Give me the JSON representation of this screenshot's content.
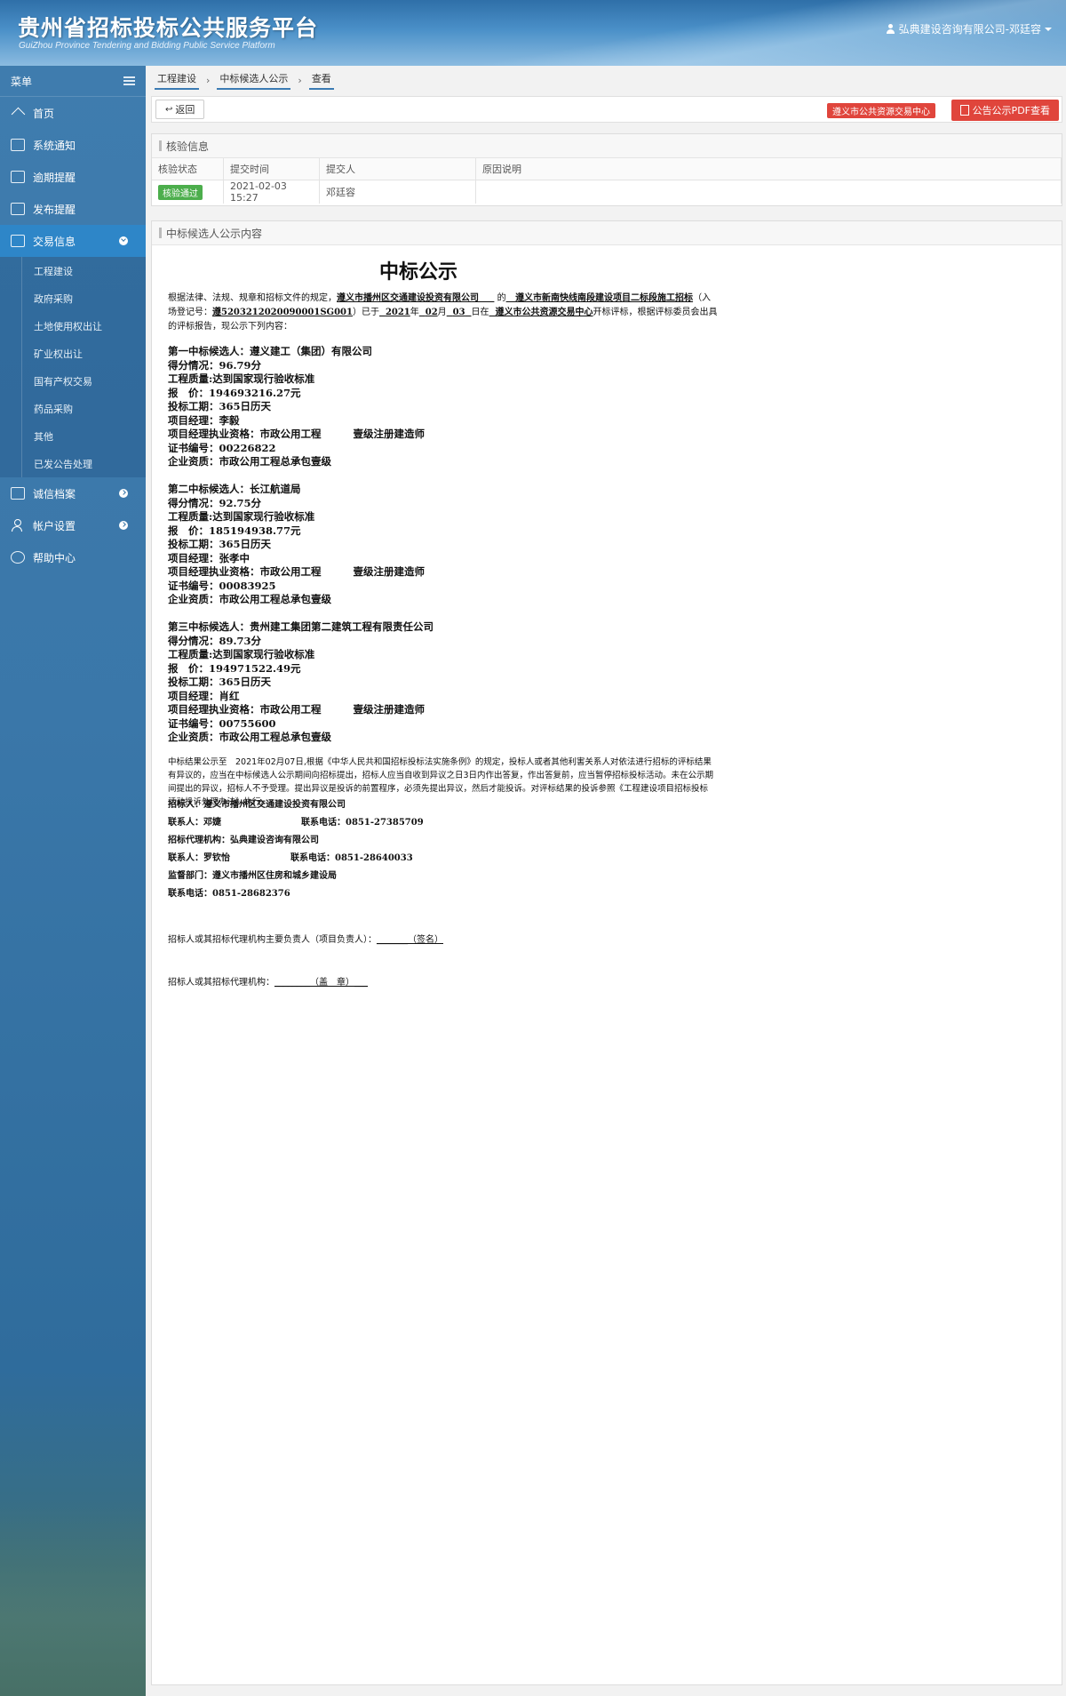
{
  "header": {
    "title_cn": "贵州省招标投标公共服务平台",
    "title_en": "GuiZhou Province Tendering and Bidding Public Service Platform",
    "user": "弘典建设咨询有限公司-邓廷容"
  },
  "sidebar": {
    "menu_label": "菜单",
    "items": [
      {
        "label": "首页",
        "icon": "home-icon"
      },
      {
        "label": "系统通知",
        "icon": "monitor-icon"
      },
      {
        "label": "逾期提醒",
        "icon": "list-icon"
      },
      {
        "label": "发布提醒",
        "icon": "list-icon"
      },
      {
        "label": "交易信息",
        "icon": "list-icon"
      }
    ],
    "sub_items": [
      "工程建设",
      "政府采购",
      "土地使用权出让",
      "矿业权出让",
      "国有产权交易",
      "药品采购",
      "其他",
      "已发公告处理"
    ],
    "bottom_items": [
      {
        "label": "诚信档案",
        "icon": "table-icon"
      },
      {
        "label": "帐户设置",
        "icon": "user-icon"
      },
      {
        "label": "帮助中心",
        "icon": "help-icon"
      }
    ]
  },
  "breadcrumb": [
    "工程建设",
    "中标候选人公示",
    "查看"
  ],
  "toolbar": {
    "back_label": "返回",
    "center_tag": "遵义市公共资源交易中心",
    "pdf_label": "公告公示PDF查看"
  },
  "check_panel": {
    "title": "核验信息",
    "headers": [
      "核验状态",
      "提交时间",
      "提交人",
      "原因说明"
    ],
    "status": "核验通过",
    "time": "2021-02-03 15:27",
    "submitter": "邓廷容",
    "reason": ""
  },
  "content_panel": {
    "title": "中标候选人公示内容"
  },
  "doc": {
    "title": "中标公示",
    "intro_a": "根据法律、法规、规章和招标文件的规定，",
    "tenderer": "遵义市播州区交通建设投资有限公司",
    "intro_b": "的",
    "project": "遵义市新南快线南段建设项目二标段施工招标",
    "intro_c": "（入场登记号：",
    "reg_no": "遵5203212020090001SG001",
    "intro_d": "）已于",
    "year": "2021",
    "mon": "02",
    "day": "03",
    "intro_e": "年",
    "intro_f": "月",
    "intro_g": "日在",
    "center": "遵义市公共资源交易中心",
    "intro_h": "开标评标，根据评标委员会出具的评标报告，现公示下列内容：",
    "candidates": [
      {
        "title": "第一中标候选人：遵义建工（集团）有限公司",
        "score": "得分情况：96.79分",
        "quality": "工程质量:达到国家现行验收标准",
        "price": "报　价：194693216.27元",
        "period": "投标工期：365日历天",
        "manager": "项目经理：李毅",
        "qual_a": "项目经理执业资格：市政公用工程",
        "qual_b": "壹级注册建造师",
        "cert": "证书编号：00226822",
        "company": "企业资质：市政公用工程总承包壹级"
      },
      {
        "title": "第二中标候选人：长江航道局",
        "score": "得分情况：92.75分",
        "quality": "工程质量:达到国家现行验收标准",
        "price": "报　价：185194938.77元",
        "period": "投标工期：365日历天",
        "manager": "项目经理：张孝中",
        "qual_a": "项目经理执业资格：市政公用工程",
        "qual_b": "壹级注册建造师",
        "cert": "证书编号：00083925",
        "company": "企业资质：市政公用工程总承包壹级"
      },
      {
        "title": "第三中标候选人：贵州建工集团第二建筑工程有限责任公司",
        "score": "得分情况：89.73分",
        "quality": "工程质量:达到国家现行验收标准",
        "price": "报　价：194971522.49元",
        "period": "投标工期：365日历天",
        "manager": "项目经理：肖红",
        "qual_a": "项目经理执业资格：市政公用工程",
        "qual_b": "壹级注册建造师",
        "cert": "证书编号：00755600",
        "company": "企业资质：市政公用工程总承包壹级"
      }
    ],
    "notice": "中标结果公示至　2021年02月07日,根据《中华人民共和国招标投标法实施条例》的规定，投标人或者其他利害关系人对依法进行招标的评标结果有异议的，应当在中标候选人公示期间向招标提出，招标人应当自收到异议之日3日内作出答复，作出答复前，应当暂停招标投标活动。未在公示期间提出的异议，招标人不予受理。提出异议是投诉的前置程序，必须先提出异议，然后才能投诉。对评标结果的投诉参照《工程建设项目招标投标活动投诉处理办法》执行。",
    "contacts": {
      "tenderer": "招标人：遵义市播州区交通建设投资有限公司",
      "contact1": "联系人：邓婕",
      "phone1": "联系电话：0851-27385709",
      "agency": "招标代理机构：弘典建设咨询有限公司",
      "contact2": "联系人：罗钦怡",
      "phone2": "联系电话：0851-28640033",
      "supervisor": "监督部门：遵义市播州区住房和城乡建设局",
      "phone3": "联系电话：0851-28682376"
    },
    "sign1_label": "招标人或其招标代理机构主要负责人（项目负责人）：",
    "sign1_blank": "_______（签名）",
    "sign2_label": "招标人或其招标代理机构：",
    "sign2_blank": "________（盖　章）___"
  }
}
